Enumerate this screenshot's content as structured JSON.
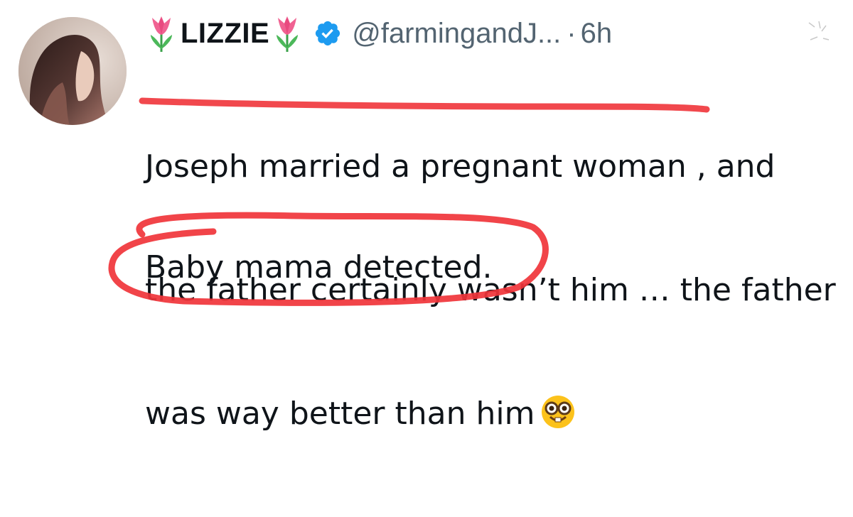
{
  "author": {
    "display_name": "LIZZIE",
    "handle": "@farmingandJ...",
    "separator": "·",
    "timestamp": "6h",
    "name_emoji": "tulip-emoji",
    "verified_icon": "verified-badge-icon"
  },
  "tweet": {
    "lines": [
      "Joseph married a pregnant woman , and",
      "the father certainly wasn’t him … the father",
      "was way better than him"
    ],
    "trailing_emoji": "nerd-face-emoji",
    "second_paragraph": "Baby mama detected."
  },
  "colors": {
    "verified_blue": "#1d9bf0",
    "annotation_red": "#f0343a",
    "text": "#0f1419",
    "secondary_text": "#536471"
  }
}
